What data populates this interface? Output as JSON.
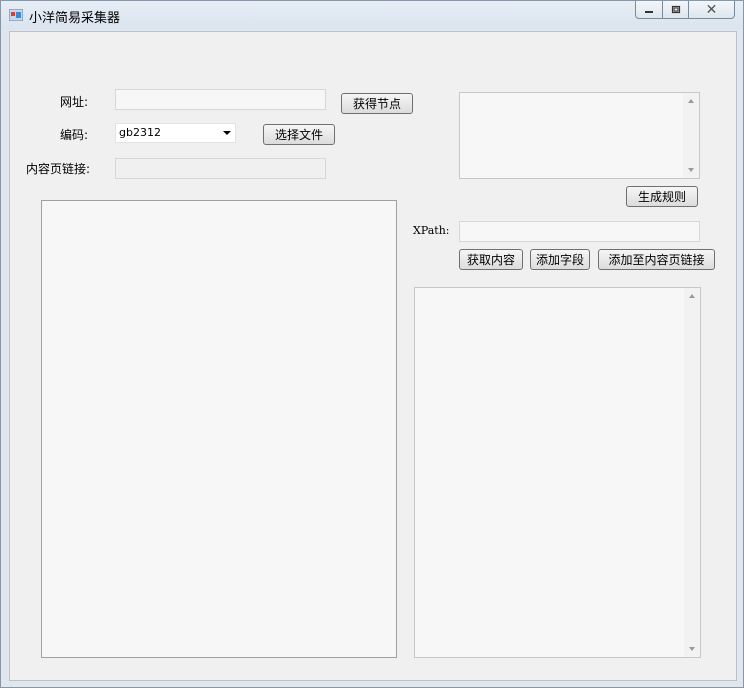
{
  "window": {
    "title": "小洋简易采集器",
    "controls": {
      "minimize_icon": "minimize-icon",
      "maximize_icon": "restore-icon",
      "close_glyph": "✕"
    }
  },
  "form": {
    "url_label": "网址:",
    "url_value": "",
    "get_nodes_button": "获得节点",
    "encoding_label": "编码:",
    "encoding_value": "gb2312",
    "choose_file_button": "选择文件",
    "content_link_label": "内容页链接:",
    "content_link_value": ""
  },
  "rules": {
    "generate_rules_button": "生成规则"
  },
  "xpath": {
    "label": "XPath:",
    "value": "",
    "get_content_button": "获取内容",
    "add_field_button": "添加字段",
    "add_to_content_link_button": "添加至内容页链接"
  },
  "colors": {
    "accent": "#2b579a",
    "client_bg": "#f0f0f0"
  }
}
